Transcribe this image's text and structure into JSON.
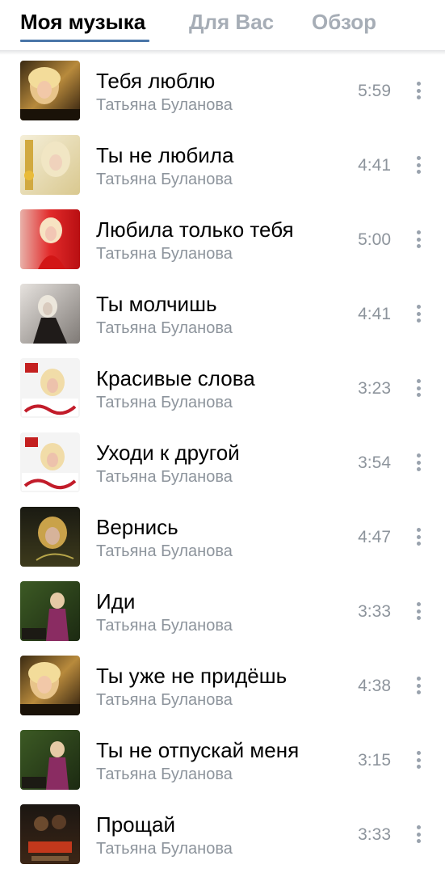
{
  "tabs": {
    "my_music": "Моя музыка",
    "for_you": "Для Вас",
    "browse": "Обзор"
  },
  "colors": {
    "accent": "#4a76a8",
    "inactive_tab": "#a6adb6",
    "secondary_text": "#8d949c"
  },
  "tracks": [
    {
      "title": "Тебя люблю",
      "artist": "Татьяна Буланова",
      "duration": "5:59",
      "cover": "cover-moy-svet",
      "cover_text": "ТАНЯ БУЛАНОВА"
    },
    {
      "title": "Ты не любила",
      "artist": "Татьяна Буланова",
      "duration": "4:41",
      "cover": "cover-gold",
      "cover_text": ""
    },
    {
      "title": "Любила только тебя",
      "artist": "Татьяна Буланова",
      "duration": "5:00",
      "cover": "cover-red",
      "cover_text": ""
    },
    {
      "title": "Ты молчишь",
      "artist": "Татьяна Буланова",
      "duration": "4:41",
      "cover": "cover-bw",
      "cover_text": ""
    },
    {
      "title": "Красивые слова",
      "artist": "Татьяна Буланова",
      "duration": "3:23",
      "cover": "cover-signature",
      "cover_text": "Буланова"
    },
    {
      "title": "Уходи к другой",
      "artist": "Татьяна Буланова",
      "duration": "3:54",
      "cover": "cover-signature",
      "cover_text": "Буланова"
    },
    {
      "title": "Вернись",
      "artist": "Татьяна Буланова",
      "duration": "4:47",
      "cover": "cover-dark-portrait",
      "cover_text": ""
    },
    {
      "title": "Иди",
      "artist": "Татьяна Буланова",
      "duration": "3:33",
      "cover": "cover-eto-ya",
      "cover_text": "Это Я"
    },
    {
      "title": "Ты уже не придёшь",
      "artist": "Татьяна Буланова",
      "duration": "4:38",
      "cover": "cover-moy-svet",
      "cover_text": "ТАНЯ БУЛАНОВА"
    },
    {
      "title": "Ты не отпускай меня",
      "artist": "Татьяна Буланова",
      "duration": "3:15",
      "cover": "cover-eto-ya",
      "cover_text": "Это Я"
    },
    {
      "title": "Прощай",
      "artist": "Татьяна Буланова",
      "duration": "3:33",
      "cover": "cover-proshay",
      "cover_text": "БУЛАНОВА"
    }
  ]
}
